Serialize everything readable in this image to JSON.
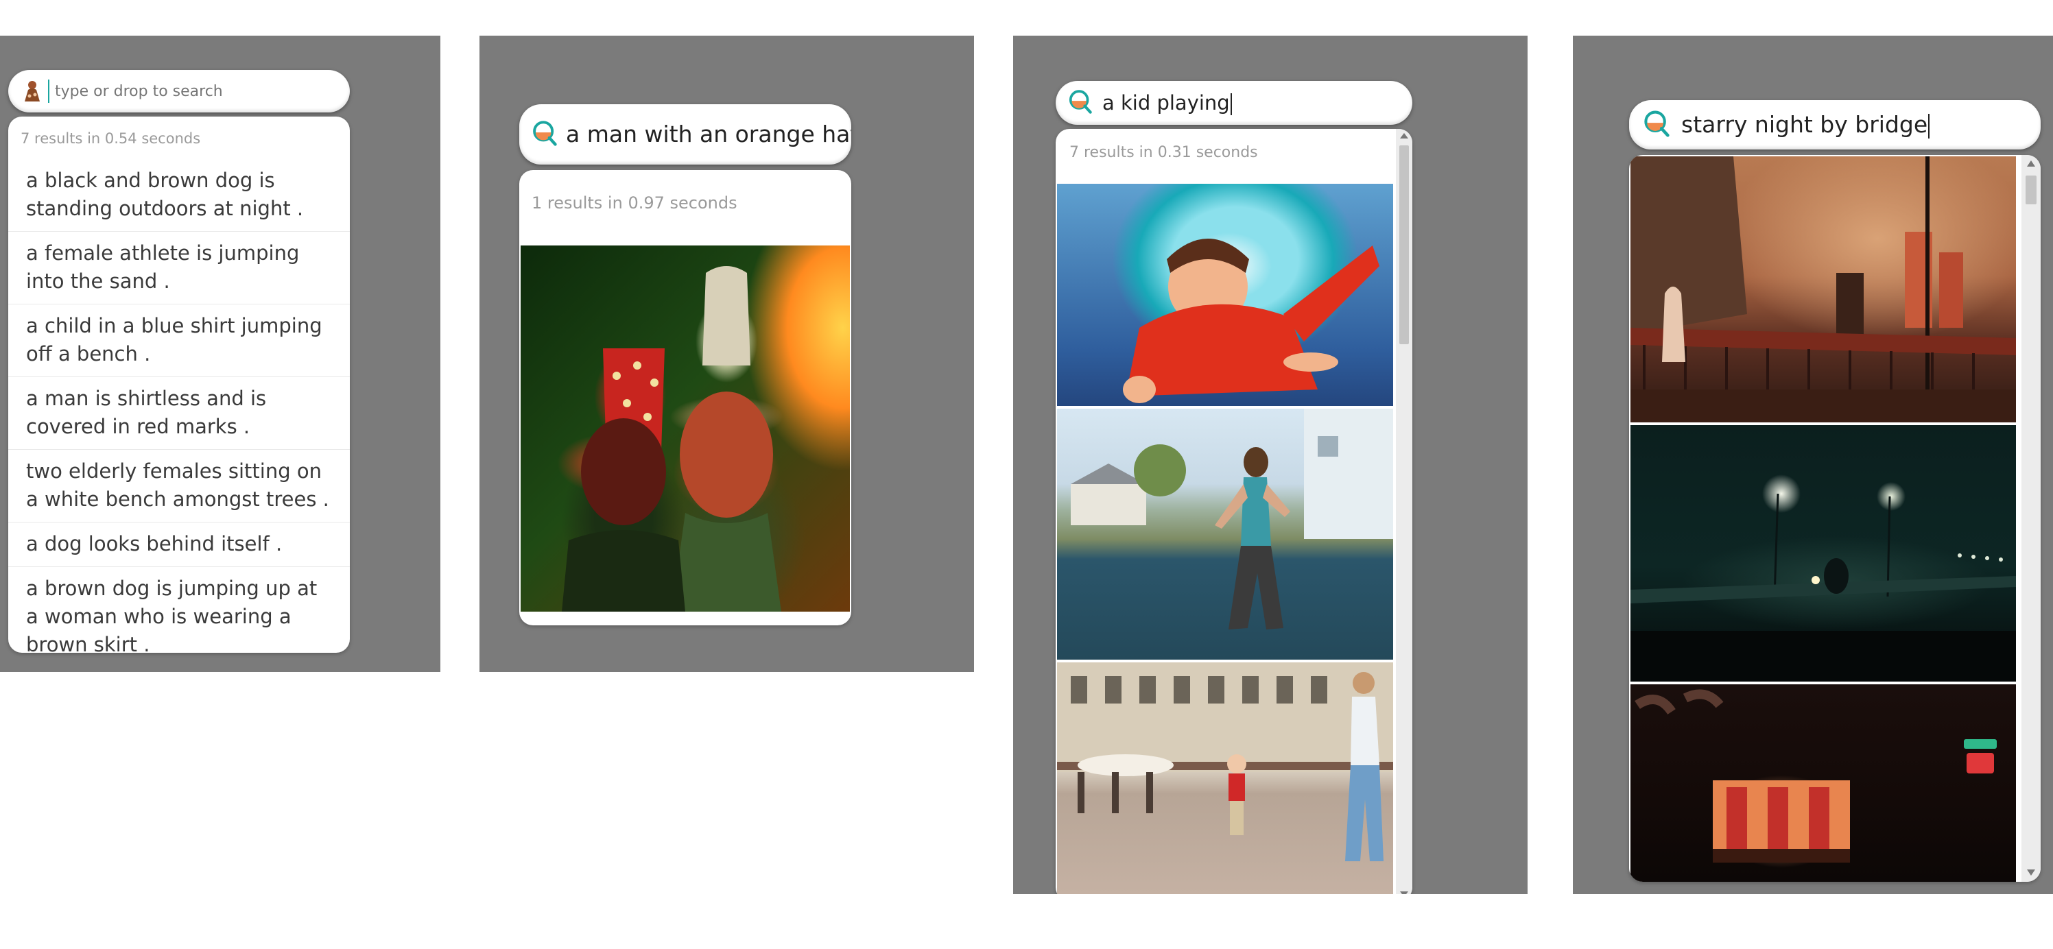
{
  "panels": [
    {
      "query": "",
      "placeholder": "type or drop to search",
      "result_count": "7 results in 0.54 seconds",
      "captions": [
        "a black and brown dog is standing outdoors at night .",
        "a female athlete is jumping into the sand .",
        "a child in a blue shirt jumping off a bench .",
        "a man is shirtless and is covered in red marks .",
        "two elderly females sitting on a white bench amongst trees .",
        "a dog looks behind itself .",
        "a brown dog is jumping up at a woman who is wearing a brown skirt ."
      ]
    },
    {
      "query": "a man with an orange hat",
      "result_count": "1 results in 0.97 seconds",
      "images": [
        "two men wearing party hats under red and green light"
      ]
    },
    {
      "query": "a kid playing",
      "result_count": "7 results in 0.31 seconds",
      "images": [
        "smiling child sliding out of a tube slide",
        "girl dancing on a sidewalk",
        "toddler walking in a town square"
      ]
    },
    {
      "query": "starry night by bridge",
      "images": [
        "person on a bridge at dusk",
        "dark street with lamps at night",
        "lit storefront at night"
      ]
    }
  ],
  "icons": {
    "search": "search-icon",
    "drop": "image-drop-icon"
  },
  "colors": {
    "panel_bg": "#7b7b7b",
    "lens_teal": "#1aa6a0",
    "lens_orange": "#f08a4b"
  }
}
